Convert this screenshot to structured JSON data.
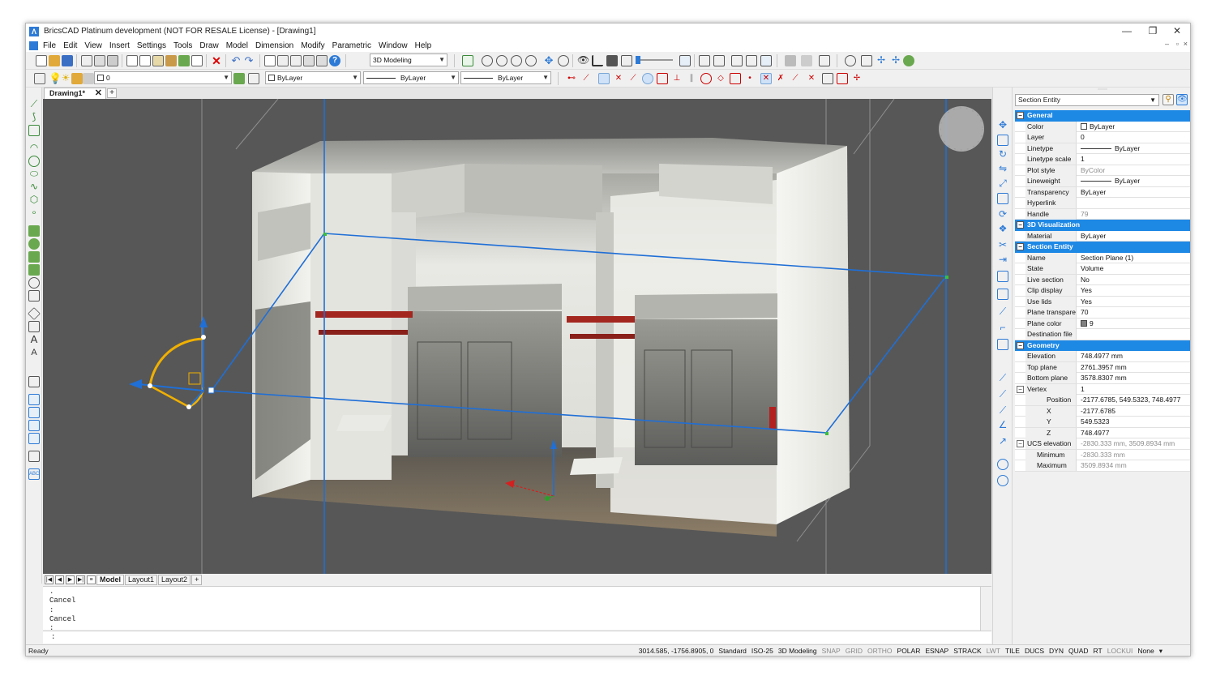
{
  "window": {
    "title": "BricsCAD Platinum development (NOT FOR RESALE License) - [Drawing1]",
    "minimize_label": "—",
    "restore_label": "❐",
    "close_label": "✕"
  },
  "menu": {
    "items": [
      "File",
      "Edit",
      "View",
      "Insert",
      "Settings",
      "Tools",
      "Draw",
      "Model",
      "Dimension",
      "Modify",
      "Parametric",
      "Window",
      "Help"
    ],
    "mdi_controls": [
      "–",
      "▫",
      "×"
    ]
  },
  "toolbar": {
    "workspace": "3D Modeling",
    "layer": "0",
    "color": "ByLayer",
    "linetype": "ByLayer",
    "lineweight": "ByLayer"
  },
  "doc_tabs": {
    "active": "Drawing1*",
    "close_label": "✕",
    "add_label": "+"
  },
  "layout_tabs": {
    "tabs": [
      "Model",
      "Layout1",
      "Layout2"
    ],
    "active_index": 0,
    "add_label": "+"
  },
  "command_line": {
    "history": [
      ".",
      "Cancel",
      ":",
      "Cancel",
      ":"
    ],
    "prompt": ":"
  },
  "status_bar": {
    "ready": "Ready",
    "coordinates": "3014.585, -1756.8905, 0",
    "items": [
      {
        "label": "Standard",
        "on": true
      },
      {
        "label": "ISO-25",
        "on": true
      },
      {
        "label": "3D Modeling",
        "on": true
      },
      {
        "label": "SNAP",
        "on": false
      },
      {
        "label": "GRID",
        "on": false
      },
      {
        "label": "ORTHO",
        "on": false
      },
      {
        "label": "POLAR",
        "on": true
      },
      {
        "label": "ESNAP",
        "on": true
      },
      {
        "label": "STRACK",
        "on": true
      },
      {
        "label": "LWT",
        "on": false
      },
      {
        "label": "TILE",
        "on": true
      },
      {
        "label": "DUCS",
        "on": true
      },
      {
        "label": "DYN",
        "on": true
      },
      {
        "label": "QUAD",
        "on": true
      },
      {
        "label": "RT",
        "on": true
      },
      {
        "label": "LOCKUI",
        "on": false
      },
      {
        "label": "None",
        "on": true
      }
    ],
    "menu_arrow": "▾"
  },
  "properties": {
    "selection": "Section Entity",
    "rows": [
      {
        "type": "category",
        "label": "General",
        "expand": "⊟"
      },
      {
        "type": "prop",
        "key": "Color",
        "value": "ByLayer",
        "swatch": "#ffffff"
      },
      {
        "type": "prop",
        "key": "Layer",
        "value": "0"
      },
      {
        "type": "prop",
        "key": "Linetype",
        "value": "ByLayer",
        "line": true
      },
      {
        "type": "prop",
        "key": "Linetype scale",
        "value": "1"
      },
      {
        "type": "prop",
        "key": "Plot style",
        "value": "ByColor",
        "gray": true
      },
      {
        "type": "prop",
        "key": "Lineweight",
        "value": "ByLayer",
        "line": true
      },
      {
        "type": "prop",
        "key": "Transparency",
        "value": "ByLayer"
      },
      {
        "type": "prop",
        "key": "Hyperlink",
        "value": ""
      },
      {
        "type": "prop",
        "key": "Handle",
        "value": "79",
        "gray": true
      },
      {
        "type": "category",
        "label": "3D Visualization",
        "expand": "⊟"
      },
      {
        "type": "prop",
        "key": "Material",
        "value": "ByLayer"
      },
      {
        "type": "category",
        "label": "Section Entity",
        "expand": "⊟"
      },
      {
        "type": "prop",
        "key": "Name",
        "value": "Section Plane (1)"
      },
      {
        "type": "prop",
        "key": "State",
        "value": "Volume"
      },
      {
        "type": "prop",
        "key": "Live section",
        "value": "No"
      },
      {
        "type": "prop",
        "key": "Clip display",
        "value": "Yes"
      },
      {
        "type": "prop",
        "key": "Use lids",
        "value": "Yes"
      },
      {
        "type": "prop",
        "key": "Plane transparen",
        "value": "70"
      },
      {
        "type": "prop",
        "key": "Plane color",
        "value": "9",
        "swatch": "#808080"
      },
      {
        "type": "prop",
        "key": "Destination file",
        "value": ""
      },
      {
        "type": "category",
        "label": "Geometry",
        "expand": "⊟"
      },
      {
        "type": "prop",
        "key": "Elevation",
        "value": "748.4977 mm"
      },
      {
        "type": "prop",
        "key": "Top plane",
        "value": "2761.3957 mm"
      },
      {
        "type": "prop",
        "key": "Bottom plane",
        "value": "3578.8307 mm"
      },
      {
        "type": "prop",
        "key": "Vertex",
        "value": "1",
        "expand": "⊟",
        "expandrow": true
      },
      {
        "type": "prop",
        "key": "Position",
        "value": "-2177.6785, 549.5323, 748.4977",
        "level": 2,
        "expand": "⊟",
        "expandrow": true
      },
      {
        "type": "prop",
        "key": "X",
        "value": "-2177.6785",
        "level": 3
      },
      {
        "type": "prop",
        "key": "Y",
        "value": "549.5323",
        "level": 3
      },
      {
        "type": "prop",
        "key": "Z",
        "value": "748.4977",
        "level": 3
      },
      {
        "type": "prop",
        "key": "UCS elevation",
        "value": "-2830.333 mm, 3509.8934 mm",
        "gray": true,
        "expand": "⊟",
        "expandrow": true
      },
      {
        "type": "prop",
        "key": "Minimum",
        "value": "-2830.333 mm",
        "gray": true,
        "level": 2
      },
      {
        "type": "prop",
        "key": "Maximum",
        "value": "3509.8934 mm",
        "gray": true,
        "level": 2
      }
    ]
  },
  "colors": {
    "accent": "#1e88e5",
    "section_plane": "#1f6fd6",
    "gizmo": "#f0b000",
    "viewport_bg": "#575757"
  }
}
